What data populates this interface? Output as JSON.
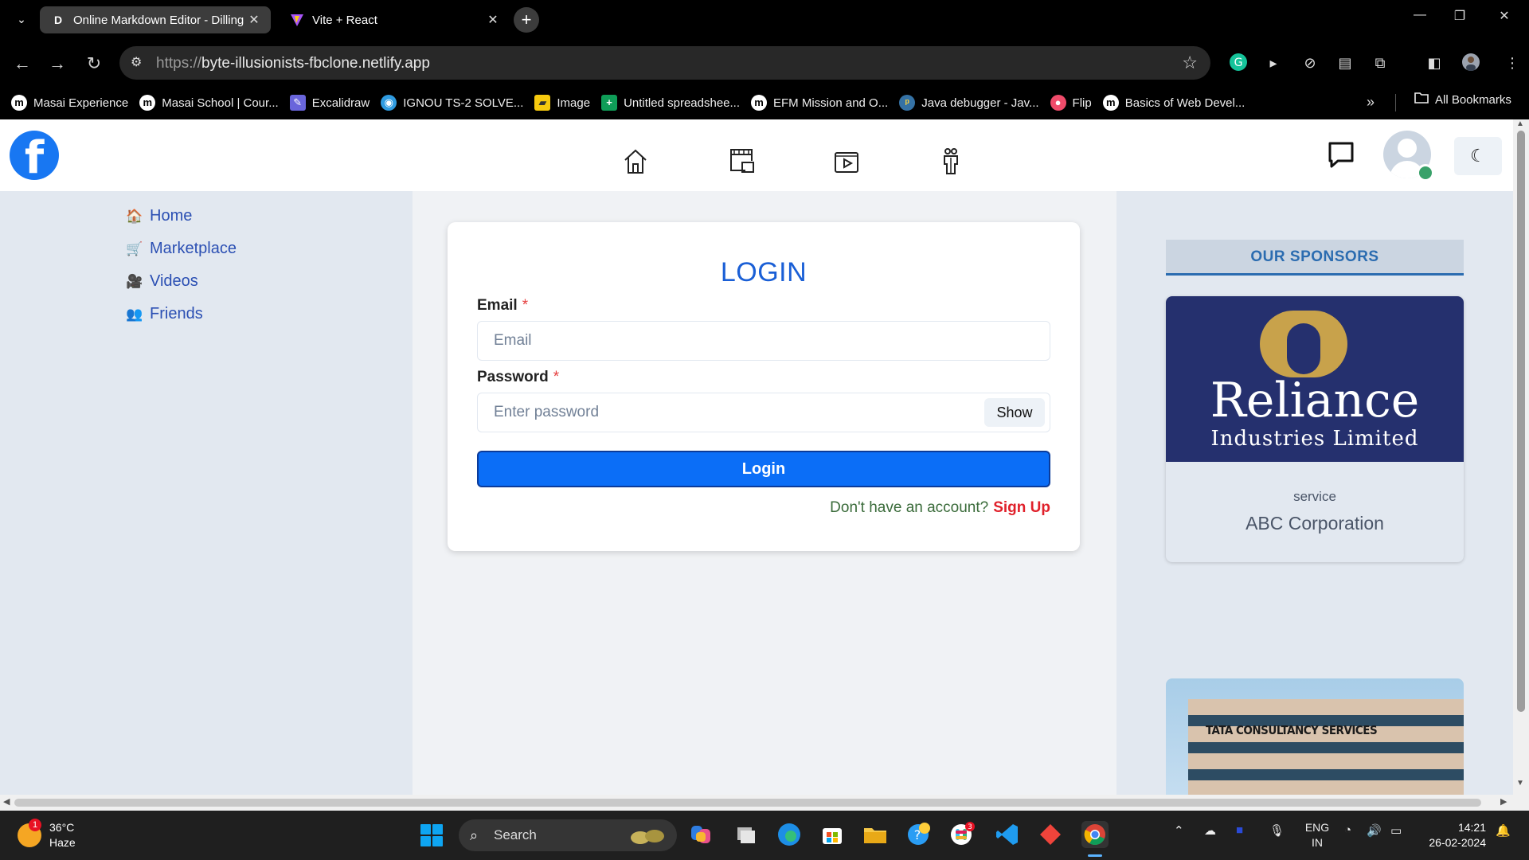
{
  "browser": {
    "tabs": [
      {
        "title": "Online Markdown Editor - Dillinger",
        "favicon": "D",
        "active": true
      },
      {
        "title": "Vite + React",
        "favicon": "vite-logo",
        "active": false
      }
    ],
    "close_glyph": "✕",
    "new_tab_glyph": "+",
    "url_scheme": "https://",
    "url_host": "byte-illusionists-fbclone.netlify.app",
    "bookmarks": [
      {
        "label": "Masai Experience",
        "icon": "m"
      },
      {
        "label": "Masai School | Cour...",
        "icon": "m"
      },
      {
        "label": "Excalidraw",
        "icon": "excalidraw"
      },
      {
        "label": "IGNOU TS-2 SOLVE...",
        "icon": "ignou"
      },
      {
        "label": "Image",
        "icon": "image"
      },
      {
        "label": "Untitled spreadshee...",
        "icon": "sheets"
      },
      {
        "label": "EFM Mission and O...",
        "icon": "m"
      },
      {
        "label": "Java debugger - Jav...",
        "icon": "python"
      },
      {
        "label": "Flip",
        "icon": "flip"
      },
      {
        "label": "Basics of Web Devel...",
        "icon": "m"
      }
    ],
    "more_bookmarks_glyph": "»",
    "all_bookmarks_label": "All Bookmarks"
  },
  "page": {
    "brand_letter": "f",
    "sidebar": [
      {
        "label": "Home",
        "icon": "🏠"
      },
      {
        "label": "Marketplace",
        "icon": "🛒"
      },
      {
        "label": "Videos",
        "icon": "🎥"
      },
      {
        "label": "Friends",
        "icon": "👥"
      }
    ],
    "theme_glyph": "☾",
    "login": {
      "title": "LOGIN",
      "email_label": "Email",
      "email_placeholder": "Email",
      "password_label": "Password",
      "password_placeholder": "Enter password",
      "required_mark": "*",
      "show_label": "Show",
      "button_label": "Login",
      "no_account_text": "Don't have an account?",
      "signup_link": "Sign Up"
    },
    "sponsors": {
      "heading": "OUR SPONSORS",
      "items": [
        {
          "brand": "Reliance",
          "brand_sub": "Industries Limited",
          "category": "service",
          "name": "ABC Corporation"
        },
        {
          "brand": "TATA CONSULTANCY SERVICES"
        }
      ]
    }
  },
  "taskbar": {
    "weather_temp": "36°C",
    "weather_desc": "Haze",
    "weather_badge": "1",
    "search_label": "Search",
    "lang_top": "ENG",
    "lang_bottom": "IN",
    "time": "14:21",
    "date": "26-02-2024"
  },
  "colors": {
    "brand_blue": "#1877f2",
    "login_title": "#1a5fd6",
    "login_button": "#0b6ef7",
    "signup_link": "#e0202a",
    "sponsor_heading": "#2b6cb0",
    "reliance_bg": "#25306e",
    "reliance_gold": "#c8a24b"
  }
}
